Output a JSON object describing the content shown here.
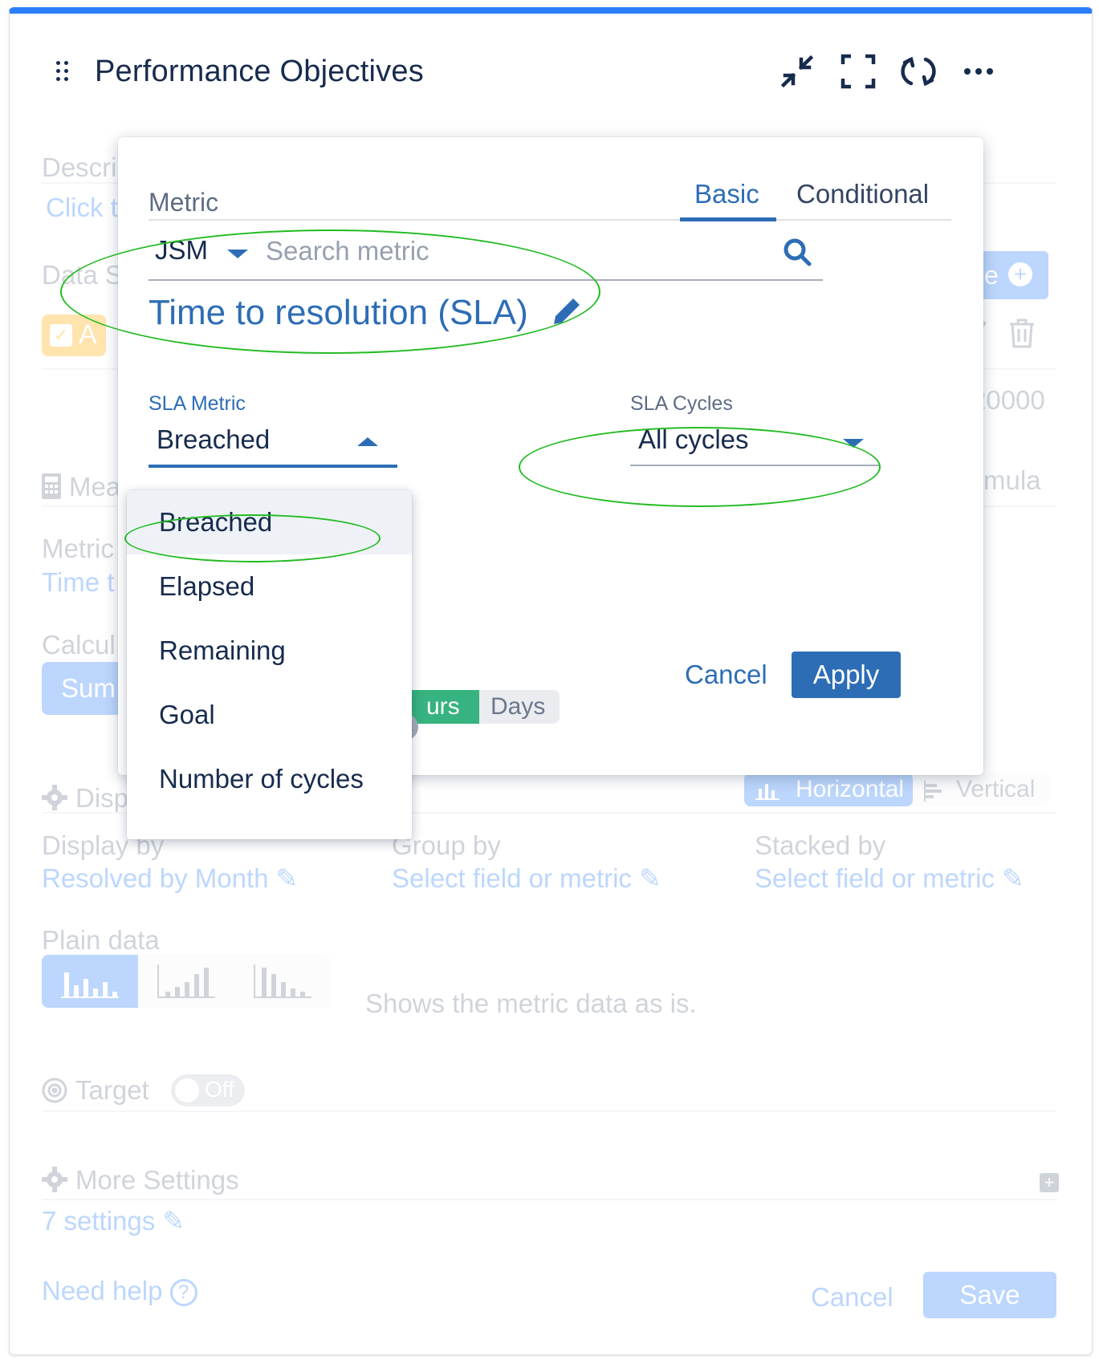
{
  "header": {
    "title": "Performance Objectives",
    "icons": [
      "drag-handle-icon",
      "collapse-icon",
      "fullscreen-icon",
      "refresh-icon",
      "more-icon"
    ]
  },
  "background": {
    "description_label": "Descri",
    "description_link": "Click t",
    "data_source_label": "Data S",
    "add_source_label": "ce",
    "source_chip": "A",
    "value_fragment": "20000",
    "measure_label": "Mea",
    "formula_fragment": "mula",
    "metric_label": "Metric",
    "metric_value": "Time t",
    "calc_label": "Calcul",
    "calc_button": "Sum",
    "hours_fragment": "urs",
    "days_label": "Days",
    "display_section": "Disp",
    "orientation_horizontal": "Horizontal",
    "orientation_vertical": "Vertical",
    "display_by_label": "Display by",
    "display_by_value": "Resolved by Month",
    "group_by_label": "Group by",
    "group_by_value": "Select field or metric",
    "stacked_by_label": "Stacked by",
    "stacked_by_value": "Select field or metric",
    "plain_data_label": "Plain data",
    "plain_data_desc": "Shows the metric data as is.",
    "target_label": "Target",
    "target_toggle": "Off",
    "more_settings_label": "More Settings",
    "settings_count": "7 settings",
    "need_help": "Need help",
    "cancel": "Cancel",
    "save": "Save"
  },
  "popup": {
    "metric_label": "Metric",
    "tabs": [
      {
        "label": "Basic",
        "active": true
      },
      {
        "label": "Conditional",
        "active": false
      }
    ],
    "source_select": "JSM",
    "search_placeholder": "Search metric",
    "selected_metric": "Time to resolution (SLA)",
    "sla_metric_label": "SLA Metric",
    "sla_metric_value": "Breached",
    "sla_cycles_label": "SLA Cycles",
    "sla_cycles_value": "All cycles",
    "cancel": "Cancel",
    "apply": "Apply"
  },
  "dropdown": {
    "options": [
      "Breached",
      "Elapsed",
      "Remaining",
      "Goal",
      "Number of cycles"
    ],
    "selected": "Breached"
  },
  "colors": {
    "accent": "#2d6db5",
    "top_bar": "#2d7ff9",
    "highlight_ellipse": "#22bb22",
    "green_segment": "#36b37e"
  }
}
